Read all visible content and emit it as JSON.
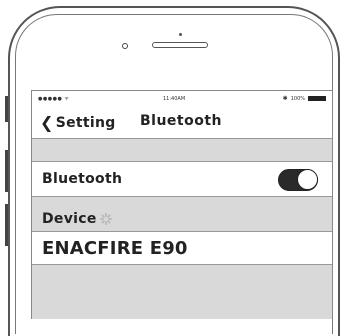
{
  "status_bar": {
    "carrier": "●●●●● ᯤ",
    "time": "11:40AM",
    "bluetooth_icon": "bluetooth-icon",
    "battery": "100%"
  },
  "nav": {
    "back_label": "Setting",
    "back_icon": "chevron-left-icon",
    "title": "Bluetooth"
  },
  "bluetooth_row": {
    "label": "Bluetooth",
    "toggle_on": true
  },
  "devices_section": {
    "label": "Device",
    "loading_icon": "spinner-icon"
  },
  "devices": [
    {
      "name": "ENACFIRE E90"
    }
  ]
}
